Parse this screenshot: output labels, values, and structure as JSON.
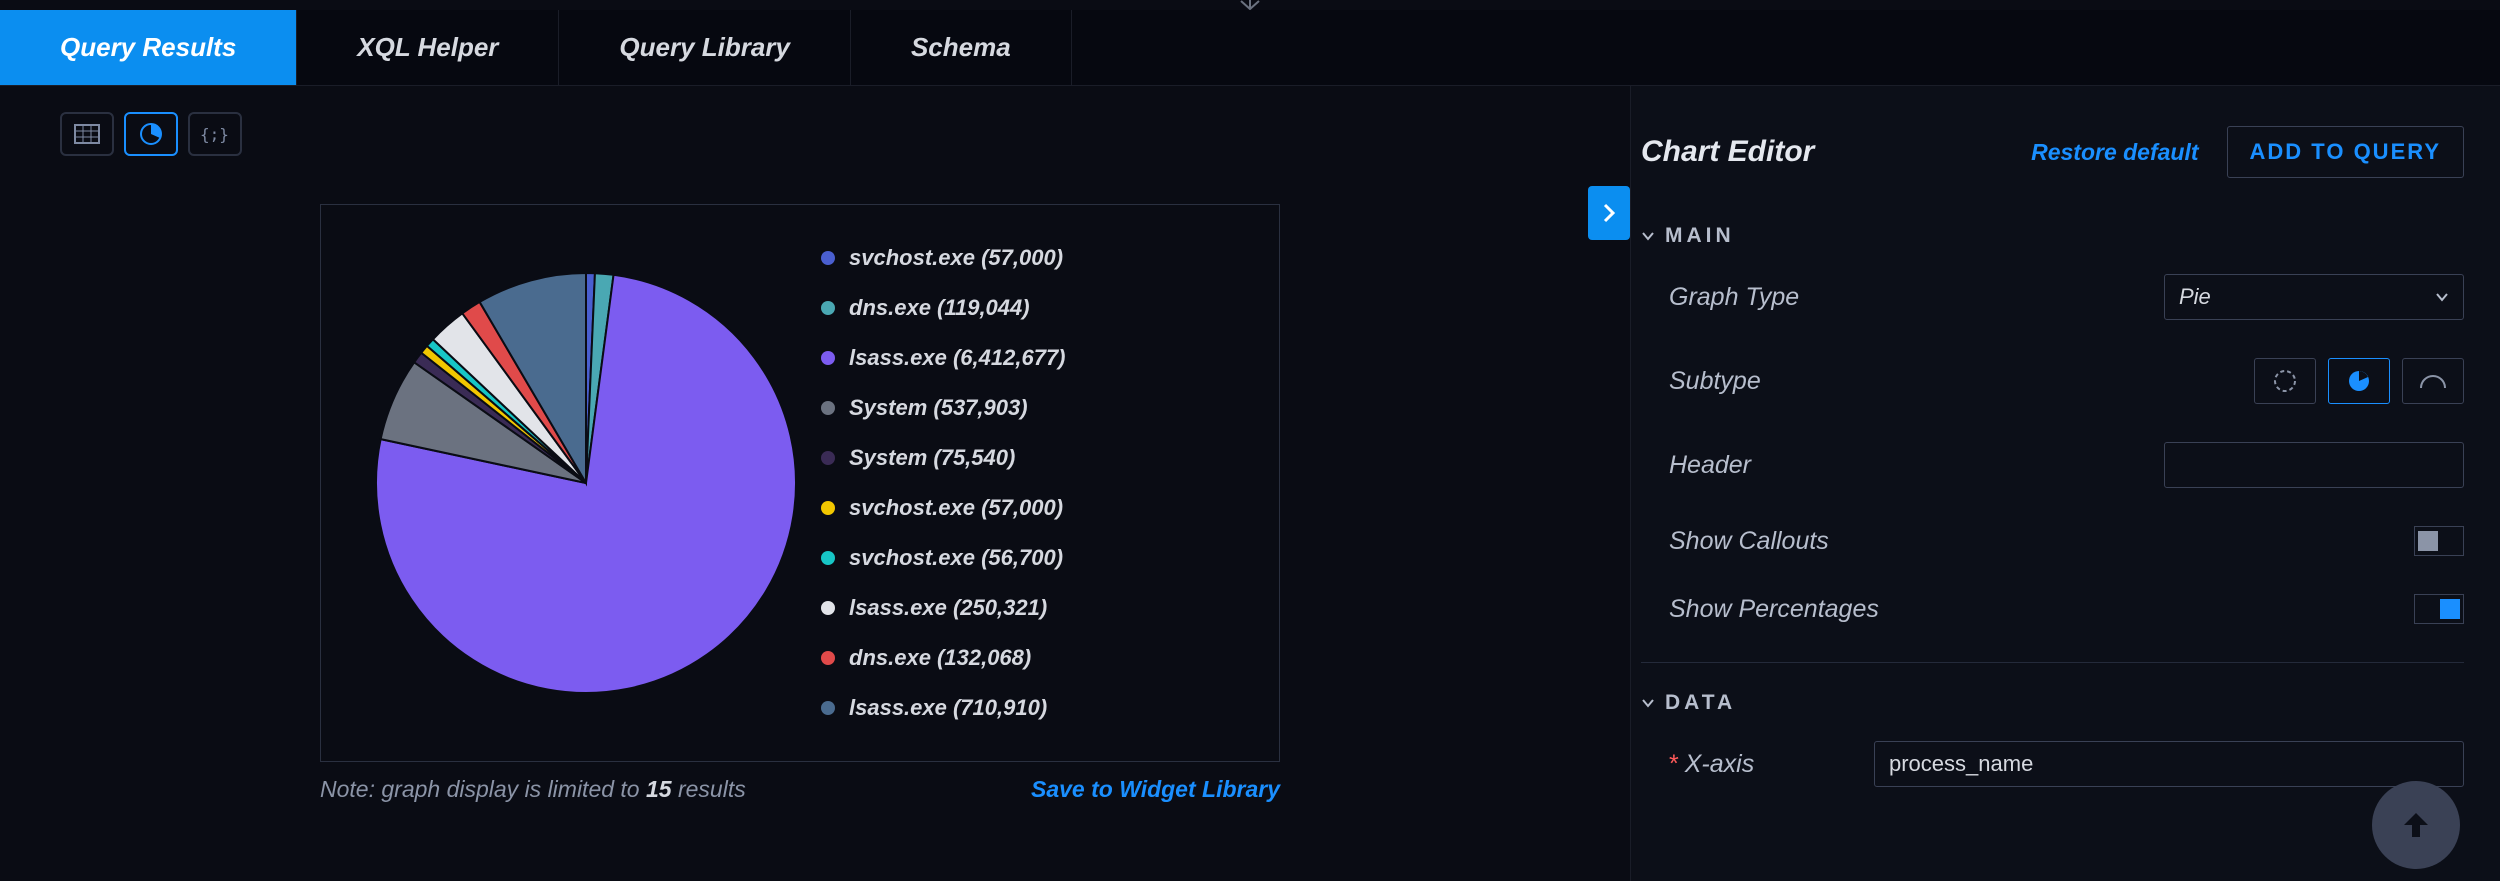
{
  "tabs": {
    "query_results": "Query Results",
    "xql_helper": "XQL Helper",
    "query_library": "Query Library",
    "schema": "Schema"
  },
  "note": {
    "prefix": "Note: graph display is limited to ",
    "count": "15",
    "suffix": " results"
  },
  "save_link": "Save to Widget Library",
  "editor": {
    "title": "Chart Editor",
    "restore": "Restore default",
    "add_to_query": "ADD TO QUERY",
    "sections": {
      "main": "MAIN",
      "data": "DATA"
    },
    "fields": {
      "graph_type_label": "Graph Type",
      "graph_type_value": "Pie",
      "subtype_label": "Subtype",
      "header_label": "Header",
      "header_value": "",
      "show_callouts_label": "Show Callouts",
      "show_percentages_label": "Show Percentages",
      "xaxis_label": "X-axis",
      "xaxis_value": "process_name"
    }
  },
  "chart_data": {
    "type": "pie",
    "title": "",
    "series": [
      {
        "name": "svchost.exe",
        "value": 57000,
        "label": "svchost.exe (57,000)",
        "color": "#4a5fd0"
      },
      {
        "name": "dns.exe",
        "value": 119044,
        "label": "dns.exe (119,044)",
        "color": "#4aa8b3"
      },
      {
        "name": "lsass.exe",
        "value": 6412677,
        "label": "lsass.exe (6,412,677)",
        "color": "#7c5cf0"
      },
      {
        "name": "System",
        "value": 537903,
        "label": "System (537,903)",
        "color": "#6b7280"
      },
      {
        "name": "System",
        "value": 75540,
        "label": "System (75,540)",
        "color": "#3a2b55"
      },
      {
        "name": "svchost.exe",
        "value": 57000,
        "label": "svchost.exe (57,000)",
        "color": "#f2c700"
      },
      {
        "name": "svchost.exe",
        "value": 56700,
        "label": "svchost.exe (56,700)",
        "color": "#17c6c6"
      },
      {
        "name": "lsass.exe",
        "value": 250321,
        "label": "lsass.exe (250,321)",
        "color": "#e2e4e9"
      },
      {
        "name": "dns.exe",
        "value": 132068,
        "label": "dns.exe (132,068)",
        "color": "#e04a4a"
      },
      {
        "name": "lsass.exe",
        "value": 710910,
        "label": "lsass.exe (710,910)",
        "color": "#4a6b8f"
      }
    ]
  }
}
